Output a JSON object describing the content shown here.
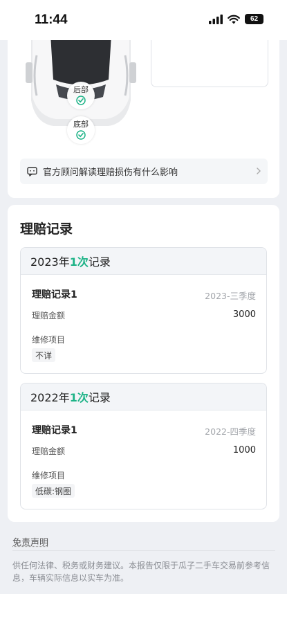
{
  "status_bar": {
    "time": "11:44",
    "battery": "62"
  },
  "car_diagram": {
    "parts": [
      {
        "label": "后部",
        "status": "ok"
      },
      {
        "label": "底部",
        "status": "ok"
      }
    ]
  },
  "advice_bar": {
    "text": "官方顾问解读理赔损伤有什么影响"
  },
  "claims": {
    "title": "理赔记录",
    "years": [
      {
        "year_prefix": "2023年",
        "count": "1次",
        "suffix": "记录",
        "records": [
          {
            "name": "理赔记录1",
            "period": "2023-三季度",
            "amount_label": "理赔金额",
            "amount": "3000",
            "items_label": "维修项目",
            "items": [
              "不详"
            ]
          }
        ]
      },
      {
        "year_prefix": "2022年",
        "count": "1次",
        "suffix": "记录",
        "records": [
          {
            "name": "理赔记录1",
            "period": "2022-四季度",
            "amount_label": "理赔金额",
            "amount": "1000",
            "items_label": "维修项目",
            "items": [
              "低碳:钢圈"
            ]
          }
        ]
      }
    ]
  },
  "disclaimer": {
    "title": "免责声明",
    "text": "供任何法律、税务或财务建议。本报告仅限于瓜子二手车交易前参考信息，车辆实际信息以实车为准。"
  },
  "colors": {
    "accent_green": "#1db387",
    "page_bg": "#eef0f4"
  }
}
